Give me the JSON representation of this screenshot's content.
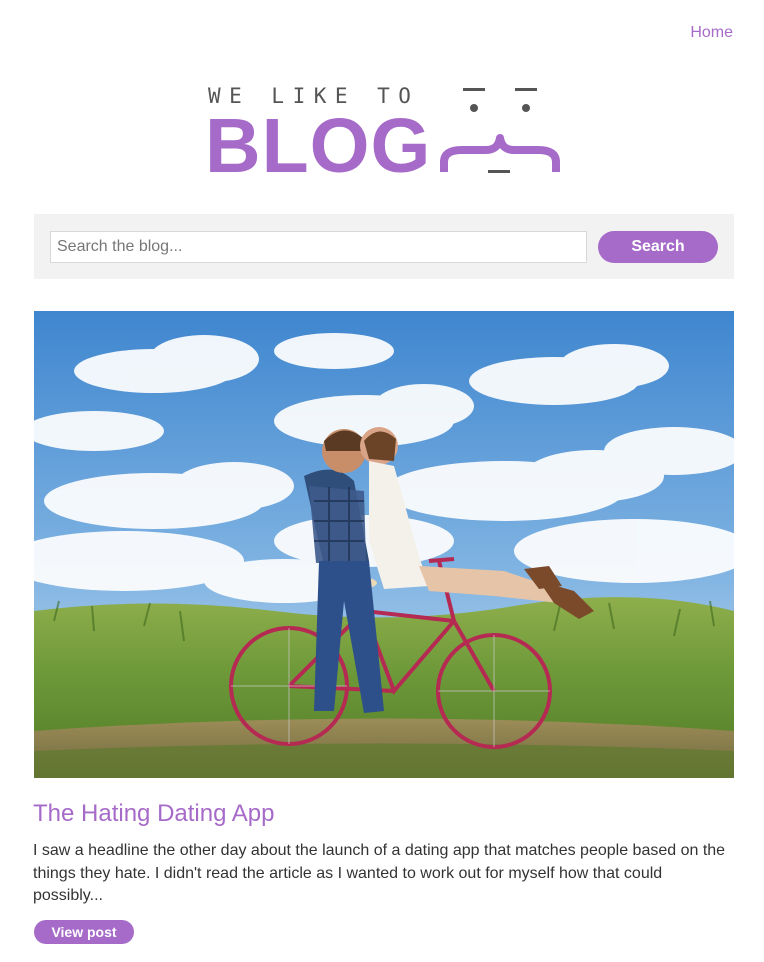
{
  "nav": {
    "home_label": "Home"
  },
  "logo": {
    "tagline": "WE LIKE TO",
    "word": "BLOG",
    "face_icon": "smirk-face-icon"
  },
  "search": {
    "placeholder": "Search the blog...",
    "value": "",
    "button_label": "Search",
    "icon": "none"
  },
  "post": {
    "image": "couple-on-bicycle-photo",
    "title": "The Hating Dating App",
    "excerpt": "I saw a headline the other day about the launch of a dating app that matches people based on the things they hate. I didn't read the article as I wanted to work out for myself how that could possibly...",
    "button_label": "View post"
  },
  "colors": {
    "accent": "#a66bc9",
    "text": "#333333",
    "search_bar_bg": "#f2f2f2",
    "tagline": "#555555"
  }
}
